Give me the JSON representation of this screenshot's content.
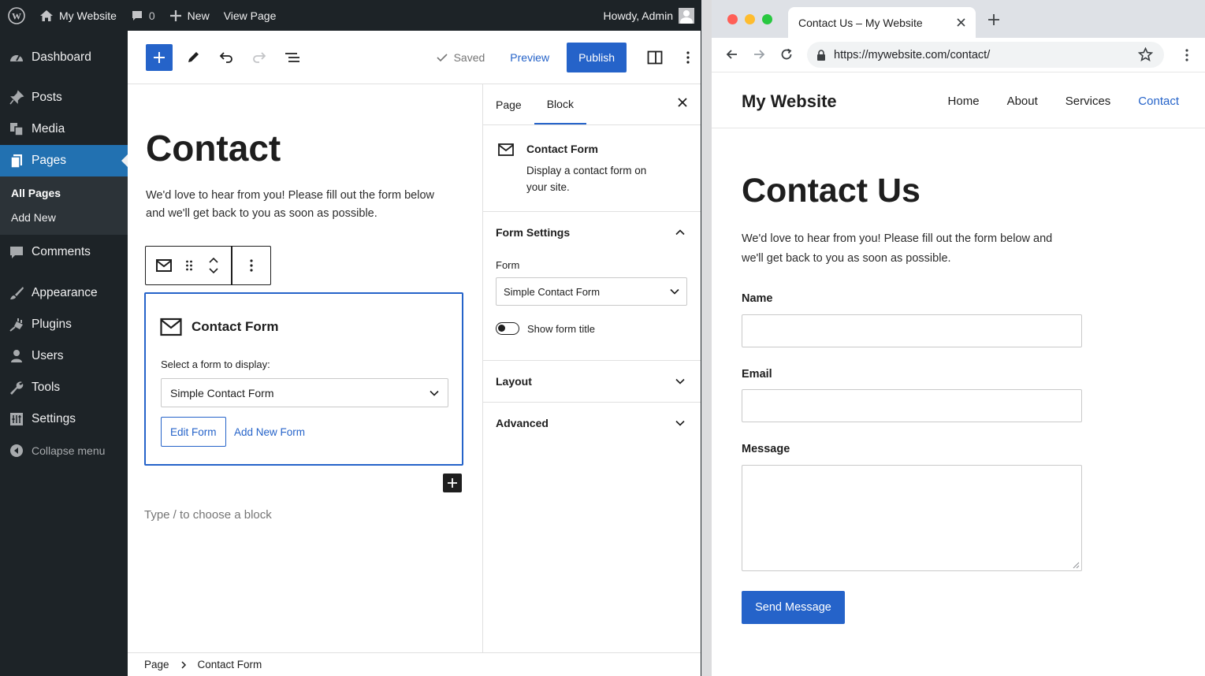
{
  "admin_bar": {
    "site_name": "My Website",
    "comments_count": "0",
    "new_label": "New",
    "view_page_label": "View Page",
    "howdy": "Howdy, Admin"
  },
  "sidebar": {
    "items": [
      {
        "label": "Dashboard",
        "icon": "dashboard-icon"
      },
      {
        "label": "Posts",
        "icon": "pin-icon"
      },
      {
        "label": "Media",
        "icon": "media-icon"
      },
      {
        "label": "Pages",
        "icon": "pages-icon",
        "current": true
      },
      {
        "label": "Comments",
        "icon": "comment-icon"
      },
      {
        "label": "Appearance",
        "icon": "brush-icon"
      },
      {
        "label": "Plugins",
        "icon": "plug-icon"
      },
      {
        "label": "Users",
        "icon": "user-icon"
      },
      {
        "label": "Tools",
        "icon": "wrench-icon"
      },
      {
        "label": "Settings",
        "icon": "settings-icon"
      }
    ],
    "submenu": [
      "All Pages",
      "Add New"
    ],
    "collapse_label": "Collapse menu"
  },
  "editor_toolbar": {
    "saved_label": "Saved",
    "preview_label": "Preview",
    "publish_label": "Publish"
  },
  "canvas": {
    "title": "Contact",
    "intro": "We'd love to hear from you! Please fill out the form below and we'll get back to you as soon as possible.",
    "block": {
      "title": "Contact Form",
      "select_label": "Select a form to display:",
      "selected_form": "Simple Contact Form",
      "edit_label": "Edit Form",
      "add_label": "Add New Form"
    },
    "placeholder": "Type / to choose a block"
  },
  "settings": {
    "tabs": [
      "Page",
      "Block"
    ],
    "active_tab": "Block",
    "block_card": {
      "title": "Contact Form",
      "description": "Display a contact form on your site."
    },
    "form_settings": {
      "heading": "Form Settings",
      "form_label": "Form",
      "form_value": "Simple Contact Form",
      "toggle_label": "Show form title",
      "toggle_on": false
    },
    "panels": [
      "Layout",
      "Advanced"
    ]
  },
  "footer": {
    "breadcrumb": [
      "Page",
      "Contact Form"
    ]
  },
  "browser": {
    "tab_title": "Contact Us – My Website",
    "url": "https://mywebsite.com/contact/",
    "traffic_colors": [
      "#ff5f57",
      "#febc2e",
      "#28c840"
    ]
  },
  "website": {
    "site_title": "My Website",
    "nav": [
      "Home",
      "About",
      "Services",
      "Contact"
    ],
    "active_nav": "Contact",
    "page_title": "Contact Us",
    "intro": "We'd love to hear from you! Please fill out the form below and we'll get back to you as soon as possible.",
    "fields": {
      "name_label": "Name",
      "email_label": "Email",
      "message_label": "Message"
    },
    "send_label": "Send Message"
  },
  "colors": {
    "accent": "#2563c9",
    "admin_dark": "#1d2327"
  }
}
